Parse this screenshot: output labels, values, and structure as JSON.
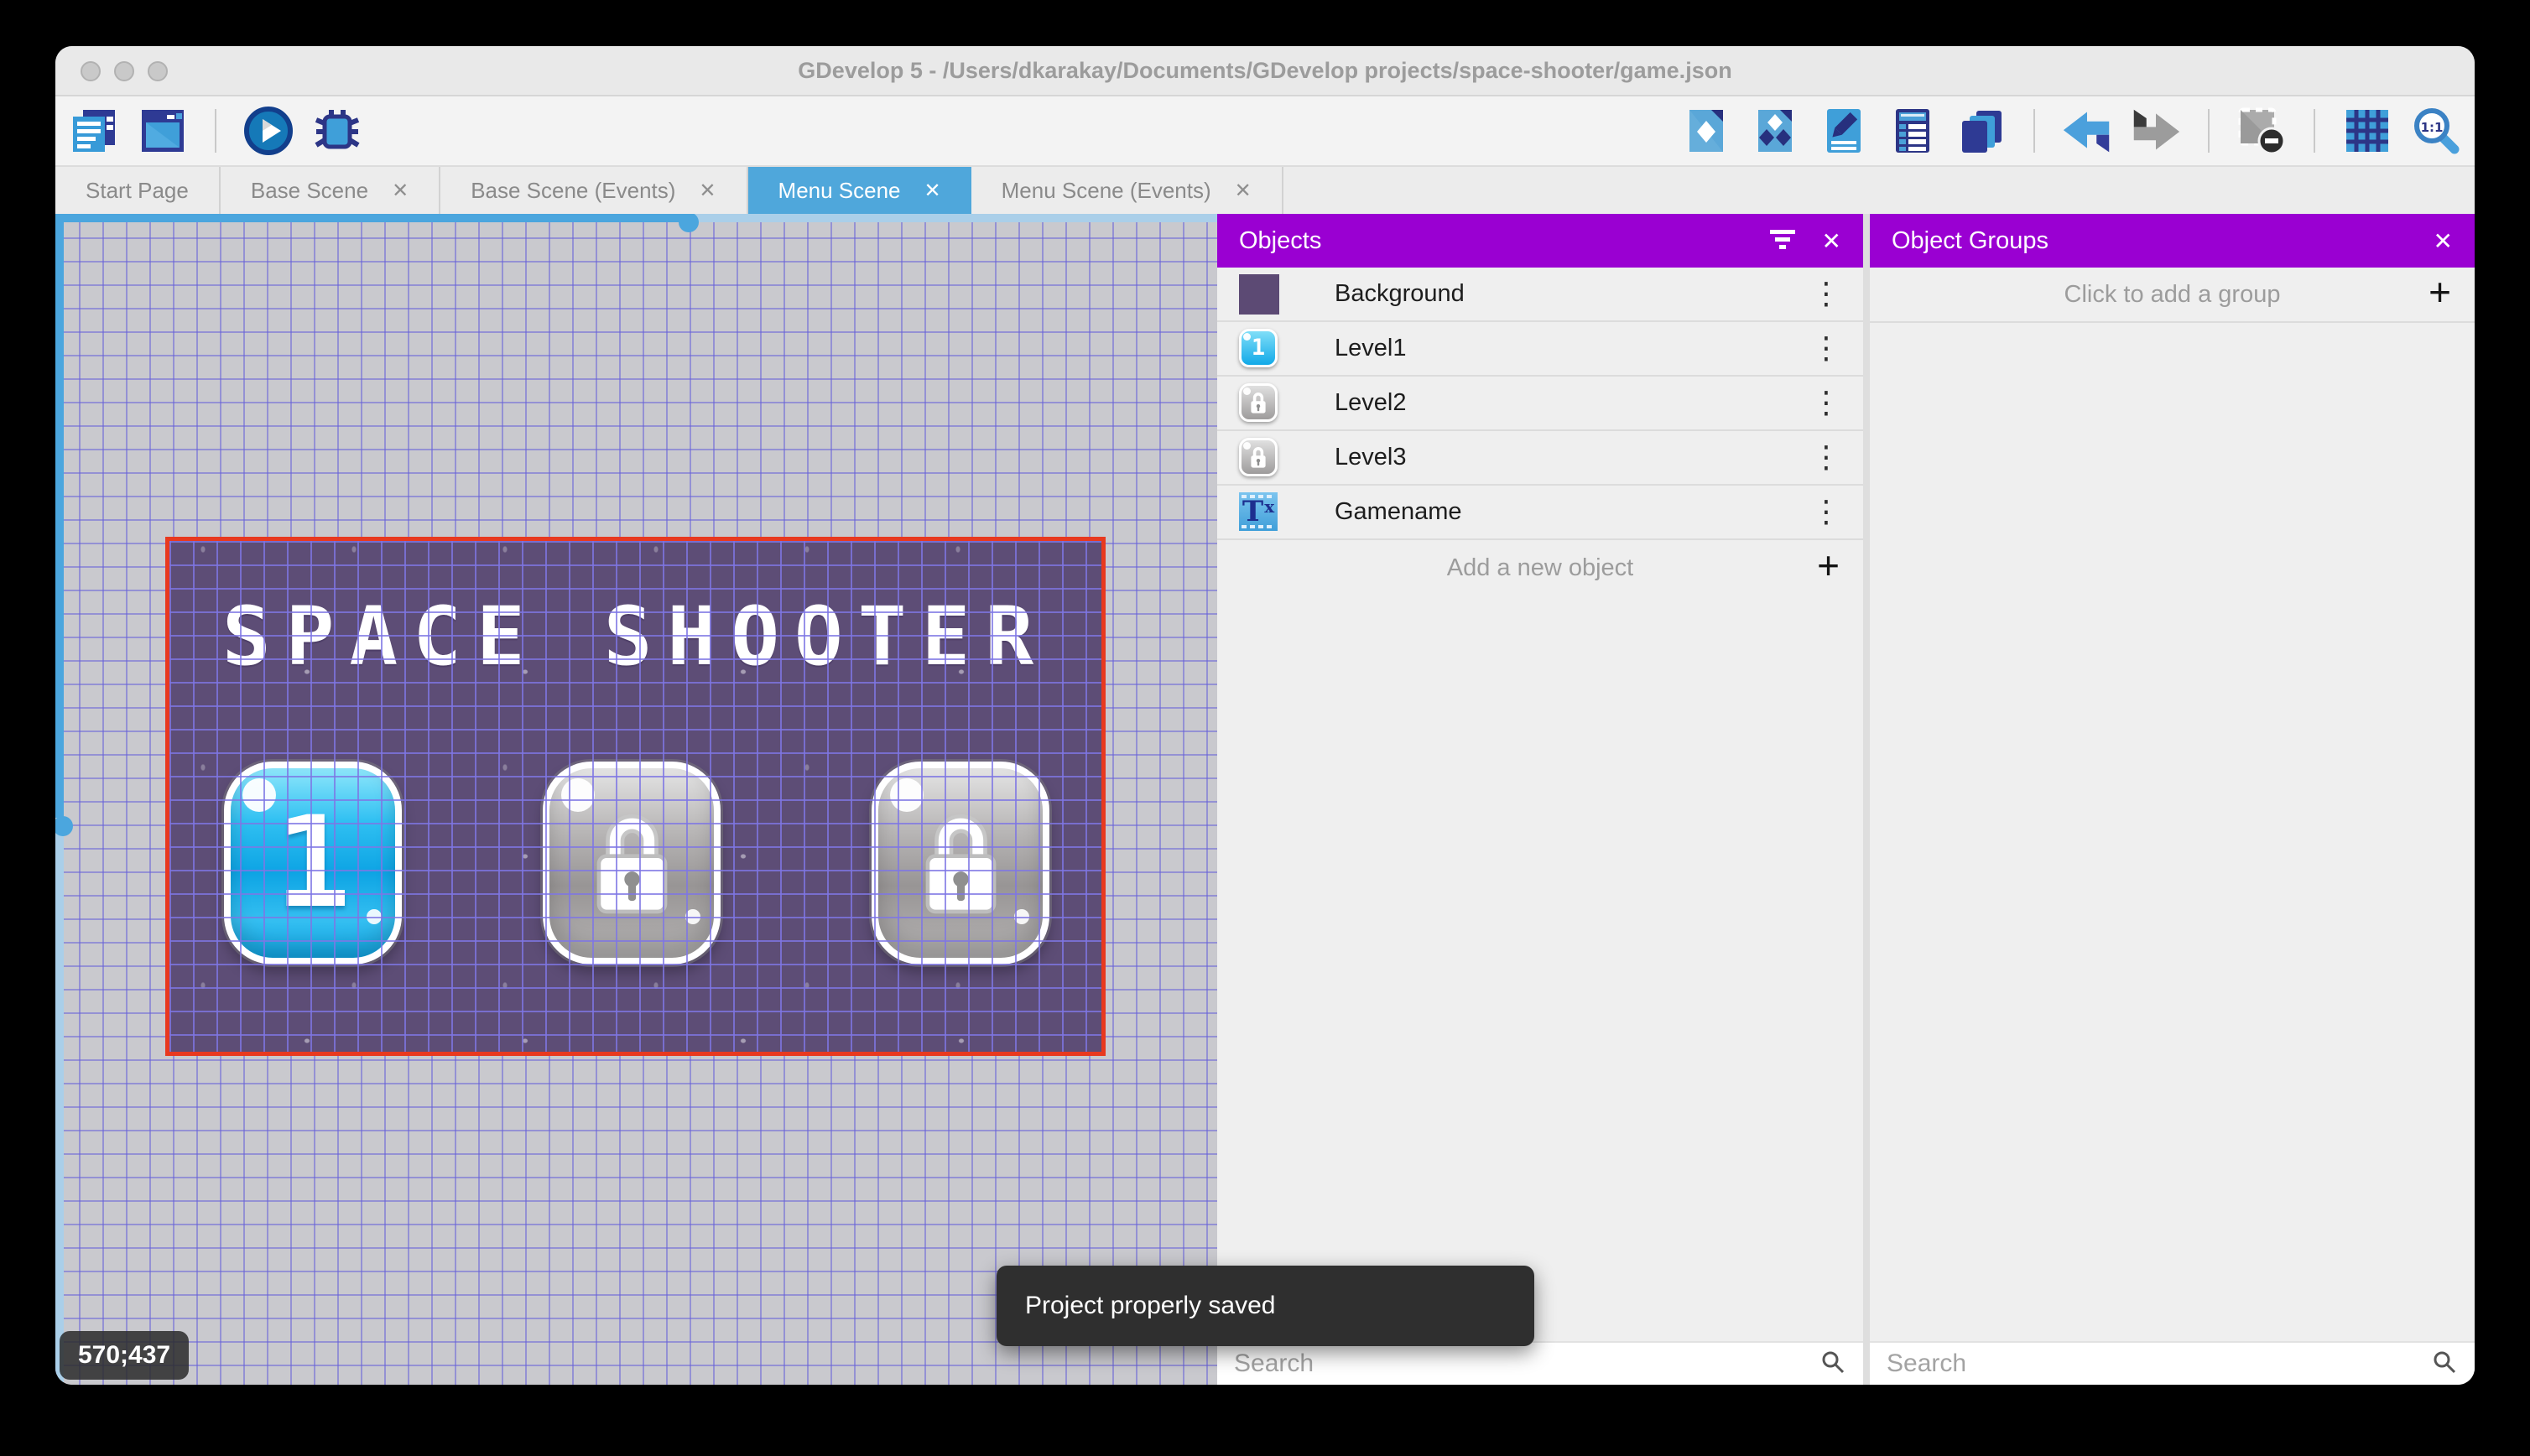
{
  "window": {
    "title": "GDevelop 5 - /Users/dkarakay/Documents/GDevelop projects/space-shooter/game.json"
  },
  "toolbar": {
    "left_icons": [
      "project-manager",
      "scene-editor",
      "preview-play",
      "debug"
    ],
    "right_icons": [
      "objects-editor",
      "object-groups",
      "properties",
      "instances-list",
      "layers",
      "undo",
      "redo",
      "mask-selection",
      "grid",
      "zoom-1-1"
    ]
  },
  "tabs": [
    {
      "label": "Start Page",
      "active": false,
      "closable": false
    },
    {
      "label": "Base Scene",
      "active": false,
      "closable": true
    },
    {
      "label": "Base Scene (Events)",
      "active": false,
      "closable": true
    },
    {
      "label": "Menu Scene",
      "active": true,
      "closable": true
    },
    {
      "label": "Menu Scene (Events)",
      "active": false,
      "closable": true
    }
  ],
  "canvas": {
    "coordinates": "570;437",
    "scene": {
      "title": "SPACE SHOOTER",
      "buttons": [
        {
          "label": "1",
          "state": "unlocked"
        },
        {
          "label": "",
          "state": "locked"
        },
        {
          "label": "",
          "state": "locked"
        }
      ]
    }
  },
  "objects_panel": {
    "title": "Objects",
    "items": [
      {
        "name": "Background",
        "icon": "background-swatch"
      },
      {
        "name": "Level1",
        "icon": "level-button-unlocked"
      },
      {
        "name": "Level2",
        "icon": "level-button-locked"
      },
      {
        "name": "Level3",
        "icon": "level-button-locked"
      },
      {
        "name": "Gamename",
        "icon": "text-object"
      }
    ],
    "add_label": "Add a new object",
    "search_placeholder": "Search"
  },
  "groups_panel": {
    "title": "Object Groups",
    "empty_label": "Click to add a group",
    "search_placeholder": "Search"
  },
  "toast": {
    "message": "Project properly saved"
  },
  "icons": {
    "close": "✕",
    "plus": "+",
    "kebab": "⋮",
    "text_t": "T",
    "text_x": "x"
  },
  "colors": {
    "header_purple": "#9a00d2",
    "active_tab_blue": "#4fa7db",
    "scene_border_red": "#e8391f",
    "scene_background": "#5d4d76",
    "scrollbar_blue": "#4ba6de"
  }
}
